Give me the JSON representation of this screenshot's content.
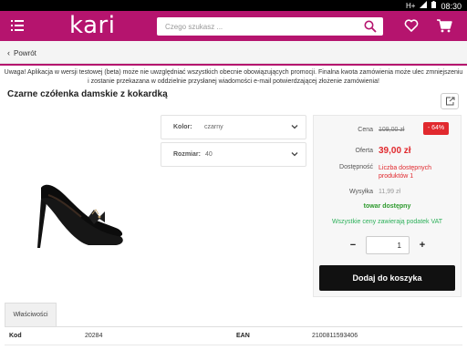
{
  "status_bar": {
    "network": "H+",
    "time": "08:30"
  },
  "header": {
    "logo": "kari",
    "search_placeholder": "Czego szukasz ...",
    "icons": [
      "menu-icon",
      "search-icon",
      "heart-icon",
      "cart-icon"
    ]
  },
  "nav": {
    "back_label": "Powrót"
  },
  "notice": "Uwaga! Aplikacja w wersji testowej (beta) może nie uwzględniać wszystkich obecnie obowiązujących promocji. Finalna kwota zamówienia może ulec zmniejszeniu i zostanie przekazana w oddzielnie przysłanej wiadomości e-mail potwierdzającej złożenie zamówienia!",
  "product": {
    "title": "Czarne czółenka damskie z kokardką",
    "options": [
      {
        "label": "Kolor:",
        "value": "czarny"
      },
      {
        "label": "Rozmiar:",
        "value": "40"
      }
    ]
  },
  "pricing": {
    "price_label": "Cena",
    "old_price": "109,00 zł",
    "discount": "- 64%",
    "offer_label": "Oferta",
    "offer_price": "39,00 zł",
    "availability_label": "Dostępność",
    "availability_value": "Liczba dostępnych produktów 1",
    "shipping_label": "Wysyłka",
    "shipping_value": "11,99 zł",
    "stock_status": "towar dostępny",
    "vat_note": "Wszystkie ceny zawierają podatek VAT",
    "quantity": "1",
    "minus": "−",
    "plus": "+",
    "add_to_cart": "Dodaj do koszyka"
  },
  "properties": {
    "tab_label": "Właściwości",
    "rows": [
      {
        "key1": "Kod",
        "val1": "20284",
        "key2": "EAN",
        "val2": "2100811593406"
      }
    ]
  },
  "colors": {
    "brand": "#b5146e",
    "price_red": "#e1292e",
    "stock_green": "#2d9a2d"
  }
}
